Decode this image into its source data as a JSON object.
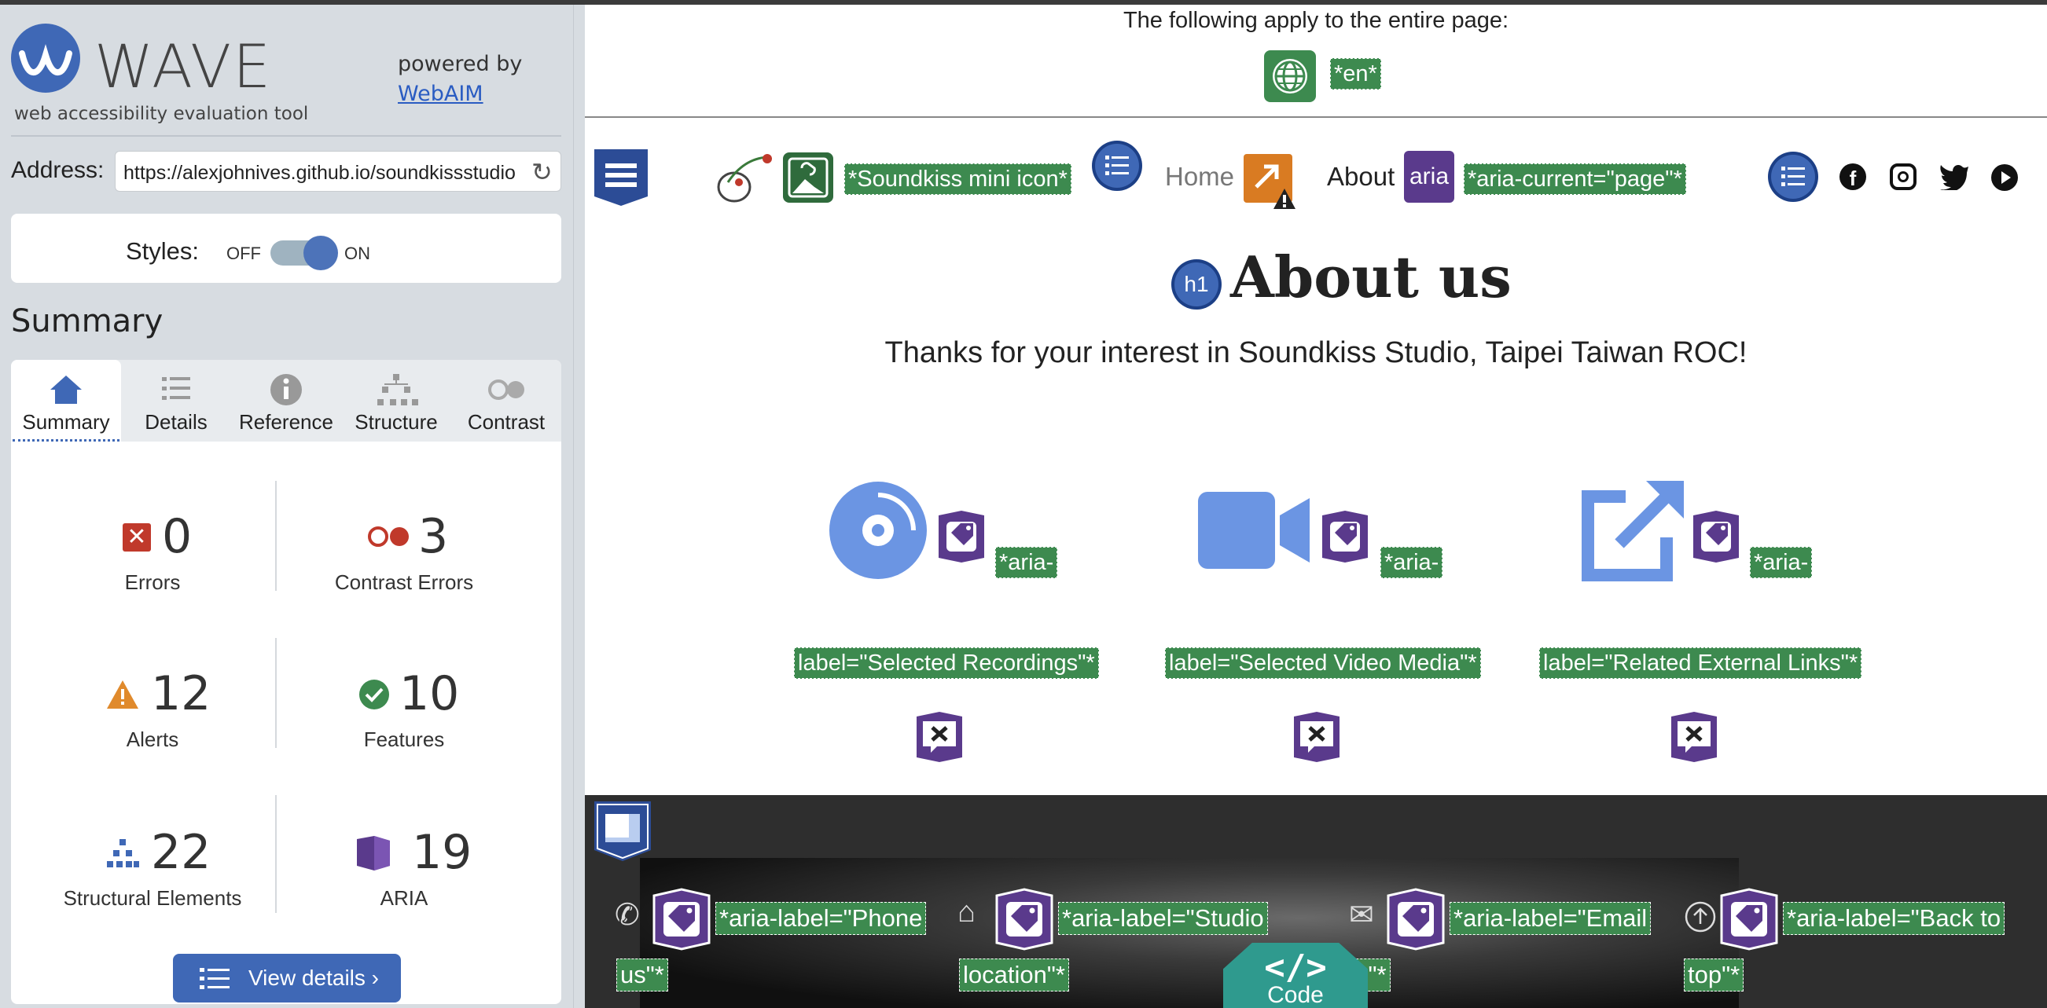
{
  "sidebar": {
    "app_name": "WAVE",
    "subtitle": "web accessibility evaluation tool",
    "powered_by": "powered by",
    "webaim_link": "WebAIM",
    "address_label": "Address:",
    "address_value": "https://alexjohnives.github.io/soundkissstudio",
    "styles_label": "Styles:",
    "styles_off": "OFF",
    "styles_on": "ON",
    "styles_state": "on",
    "summary_heading": "Summary",
    "tabs": [
      {
        "label": "Summary",
        "icon": "home-icon",
        "active": true
      },
      {
        "label": "Details",
        "icon": "list-icon",
        "active": false
      },
      {
        "label": "Reference",
        "icon": "info-icon",
        "active": false
      },
      {
        "label": "Structure",
        "icon": "hierarchy-icon",
        "active": false
      },
      {
        "label": "Contrast",
        "icon": "contrast-icon",
        "active": false
      }
    ],
    "stats": {
      "errors": {
        "count": "0",
        "label": "Errors",
        "color": "#c0392b"
      },
      "contrast_errors": {
        "count": "3",
        "label": "Contrast Errors",
        "color": "#c0392b"
      },
      "alerts": {
        "count": "12",
        "label": "Alerts",
        "color": "#e08a2c"
      },
      "features": {
        "count": "10",
        "label": "Features",
        "color": "#3d8a4f"
      },
      "structural": {
        "count": "22",
        "label": "Structural Elements",
        "color": "#3f68b6"
      },
      "aria": {
        "count": "19",
        "label": "ARIA",
        "color": "#5a3a8c"
      }
    },
    "view_details": "View details ›"
  },
  "page": {
    "apply_text": "The following apply to the entire page:",
    "lang_label": "*en*",
    "nav": {
      "icon_label": "*Soundkiss mini icon*",
      "home": "Home",
      "about": "About",
      "aria_badge": "aria",
      "aria_current": "*aria-current=\"page\"*"
    },
    "heading": "About us",
    "h1_badge": "h1",
    "thanks": "Thanks for your interest in Soundkiss Studio, Taipei Taiwan ROC!",
    "cards": [
      {
        "aria_top": "*aria-",
        "aria_bottom": "label=\"Selected Recordings\"*",
        "icon": "disc-icon"
      },
      {
        "aria_top": "*aria-",
        "aria_bottom": "label=\"Selected Video Media\"*",
        "icon": "video-camera-icon"
      },
      {
        "aria_top": "*aria-",
        "aria_bottom": "label=\"Related External Links\"*",
        "icon": "external-link-icon"
      }
    ],
    "footer": [
      {
        "top": "*aria-label=\"Phone",
        "bottom": "us\"*",
        "icon": "phone-icon"
      },
      {
        "top": "*aria-label=\"Studio",
        "bottom": "location\"*",
        "icon": "home-outline-icon"
      },
      {
        "top": "*aria-label=\"Email",
        "bottom": "s\"*",
        "icon": "envelope-icon"
      },
      {
        "top": "*aria-label=\"Back to",
        "bottom": "top\"*",
        "icon": "arrow-up-circle-icon"
      }
    ],
    "code_button": "Code"
  },
  "colors": {
    "wave_blue": "#3f68b6",
    "feature_green": "#3d8a4f",
    "aria_purple": "#5a3a8c",
    "code_teal": "#2f9a8e"
  }
}
